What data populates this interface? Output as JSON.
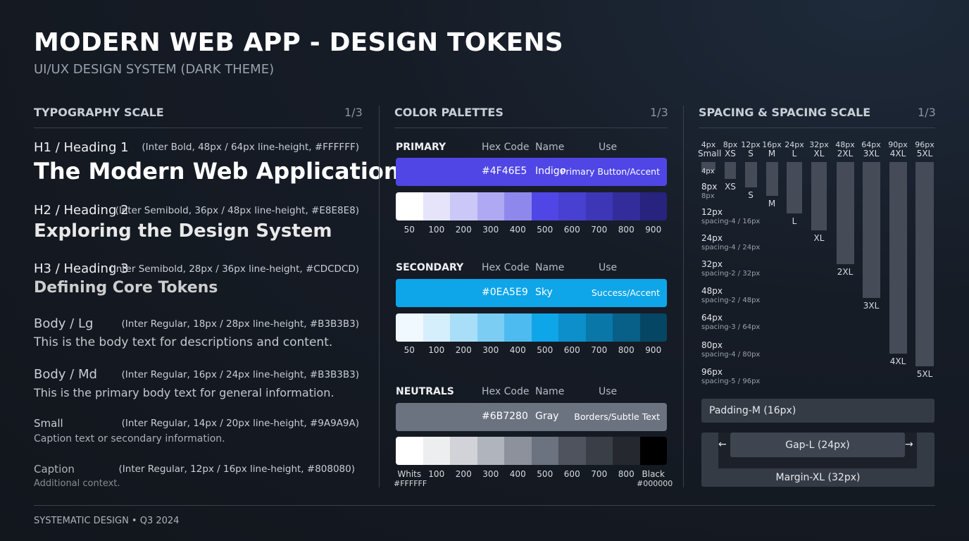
{
  "header": {
    "title": "MODERN WEB APP - DESIGN TOKENS",
    "subtitle": "UI/UX DESIGN SYSTEM (DARK THEME)"
  },
  "typography": {
    "heading": "TYPOGRAPHY SCALE",
    "page": "1/3",
    "h1": {
      "label": "H1 / Heading 1",
      "spec": "(Inter Bold, 48px / 64px line-height, #FFFFFF)",
      "sample": "The Modern Web Application"
    },
    "h2": {
      "label": "H2 / Heading 2",
      "spec": "(Inter Semibold, 36px / 48px line-height, #E8E8E8)",
      "sample": "Exploring the Design System"
    },
    "h3": {
      "label": "H3 / Heading 3",
      "spec": "(Inter Semibold, 28px / 36px line-height, #CDCDCD)",
      "sample": "Defining Core Tokens"
    },
    "body_lg": {
      "label": "Body / Lg",
      "spec": "(Inter Regular, 18px / 28px line-height, #B3B3B3)",
      "sample": "This is the body text for descriptions and content."
    },
    "body_md": {
      "label": "Body / Md",
      "spec": "(Inter Regular, 16px / 24px line-height, #B3B3B3)",
      "sample": "This is the primary body text for general information."
    },
    "small": {
      "label": "Small",
      "spec": "(Inter Regular, 14px / 20px line-height, #9A9A9A)",
      "sample": "Caption text or secondary information."
    },
    "caption": {
      "label": "Caption",
      "spec": "(Inter Regular, 12px / 16px line-height, #808080)",
      "sample": "Additional context."
    }
  },
  "colors": {
    "heading": "COLOR PALETTES",
    "page": "1/3",
    "col_hex": "Hex Code",
    "col_name": "Name",
    "col_use": "Use",
    "primary": {
      "title": "PRIMARY",
      "hex": "#4F46E5",
      "name": "Indigo",
      "use": "Primary Button/Accent",
      "bar_color": "#4F46E5",
      "ramp": [
        "#FFFFFF",
        "#E5E4FB",
        "#CBC8F7",
        "#AEA9F2",
        "#8F88EC",
        "#4F46E5",
        "#4740D0",
        "#3D37B7",
        "#322D9B",
        "#27237F"
      ],
      "steps": [
        "50",
        "100",
        "200",
        "300",
        "400",
        "500",
        "600",
        "700",
        "800",
        "900"
      ]
    },
    "secondary": {
      "title": "SECONDARY",
      "hex": "#0EA5E9",
      "name": "Sky",
      "use": "Success/Accent",
      "bar_color": "#0EA5E9",
      "ramp": [
        "#F0F9FF",
        "#D6EFFC",
        "#A9DEF8",
        "#7BCDF4",
        "#4DBBF0",
        "#0EA5E9",
        "#0C8FCB",
        "#0A77A9",
        "#085F87",
        "#064665"
      ],
      "steps": [
        "50",
        "100",
        "200",
        "300",
        "400",
        "500",
        "600",
        "700",
        "800",
        "900"
      ]
    },
    "neutrals": {
      "title": "NEUTRALS",
      "hex": "#6B7280",
      "name": "Gray",
      "use": "Borders/Subtle Text",
      "bar_color": "#6B7280",
      "ramp": [
        "#FFFFFF",
        "#EDEEF0",
        "#D1D3D8",
        "#B0B4BC",
        "#8C919B",
        "#6B7280",
        "#4E535D",
        "#3A3E46",
        "#25282E",
        "#000000"
      ],
      "steps": [
        "Whits",
        "100",
        "200",
        "300",
        "400",
        "500",
        "600",
        "700",
        "800",
        "Black"
      ],
      "white_hex": "#FFFFFF",
      "black_hex": "#000000"
    }
  },
  "spacing": {
    "heading": "SPACING & SPACING SCALE",
    "page": "1/3",
    "scale": [
      {
        "px": "4px",
        "name": "Small",
        "label": "",
        "value": 4
      },
      {
        "px": "8px",
        "name": "XS",
        "label": "XS",
        "value": 8
      },
      {
        "px": "12px",
        "name": "S",
        "label": "S",
        "value": 12
      },
      {
        "px": "16px",
        "name": "M",
        "label": "M",
        "value": 16
      },
      {
        "px": "24px",
        "name": "L",
        "label": "L",
        "value": 24
      },
      {
        "px": "32px",
        "name": "XL",
        "label": "XL",
        "value": 32
      },
      {
        "px": "48px",
        "name": "2XL",
        "label": "2XL",
        "value": 48
      },
      {
        "px": "64px",
        "name": "3XL",
        "label": "3XL",
        "value": 64
      },
      {
        "px": "90px",
        "name": "4XL",
        "label": "4XL",
        "value": 90
      },
      {
        "px": "96px",
        "name": "5XL",
        "label": "5XL",
        "value": 96
      }
    ],
    "rows": [
      {
        "a": "4px",
        "b": ""
      },
      {
        "a": "8px",
        "b": "8px"
      },
      {
        "a": "12px",
        "b": "spacing-4 / 16px"
      },
      {
        "a": "24px",
        "b": "spacing-4 / 24px"
      },
      {
        "a": "32px",
        "b": "spacing-2 / 32px"
      },
      {
        "a": "48px",
        "b": "spacing-2 / 48px"
      },
      {
        "a": "64px",
        "b": "spacing-3 / 64px"
      },
      {
        "a": "80px",
        "b": "spacing-4 / 80px"
      },
      {
        "a": "96px",
        "b": "spacing-5 / 96px"
      }
    ],
    "padding_label": "Padding-M (16px)",
    "gap_label": "Gap-L (24px)",
    "margin_label": "Margin-XL (32px)",
    "arrow_left": "←",
    "arrow_right": "→"
  },
  "footer": "SYSTEMATIC DESIGN • Q3 2024"
}
